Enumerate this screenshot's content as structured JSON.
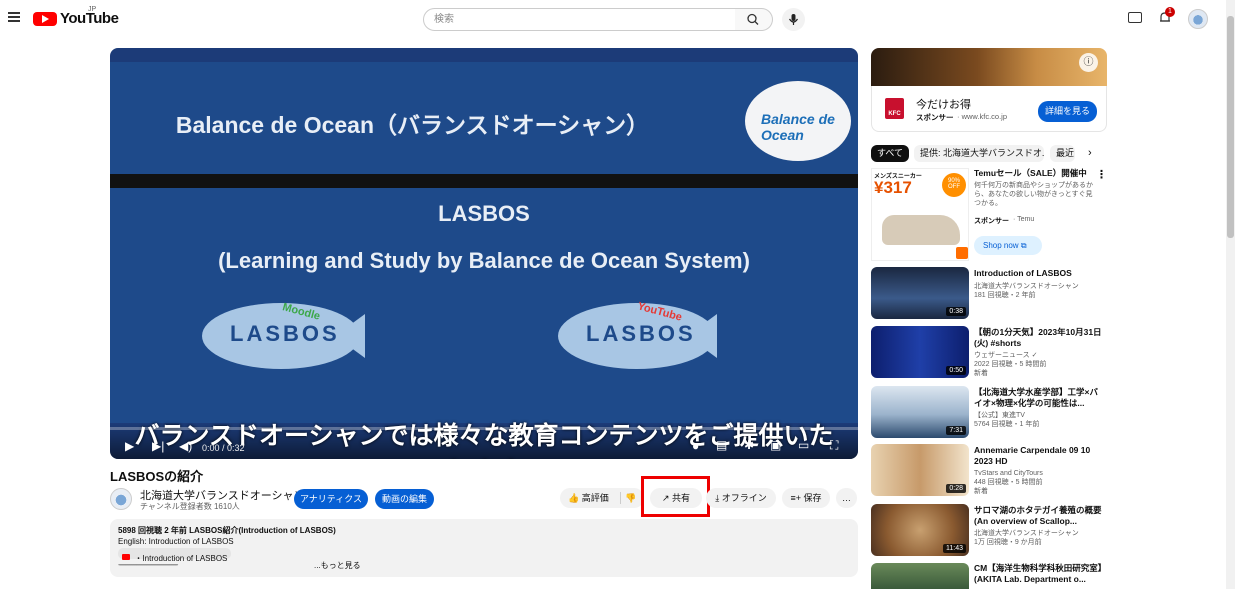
{
  "header": {
    "logo_text": "YouTube",
    "logo_region": "JP",
    "search_placeholder": "検索",
    "notification_count": "1"
  },
  "player": {
    "slide_title": "Balance de Ocean（バランスドオーシャン）",
    "logo_text": "Balance de Ocean",
    "lasbos_title": "LASBOS",
    "lasbos_subtitle": "(Learning and Study by Balance de Ocean System)",
    "fish_label": "LASBOS",
    "fish_tag_left": "Moodle",
    "fish_tag_right": "YouTube",
    "caption": "バランスドオーシャンでは様々な教育コンテンツをご提供いたします",
    "time": "0:00 / 0:32",
    "progress": 0
  },
  "video": {
    "title": "LASBOSの紹介",
    "channel_name": "北海道大学バランスドオーシャン",
    "subscribers": "チャンネル登録者数 1610人",
    "analytics_label": "アナリティクス",
    "edit_label": "動画の編集",
    "like_label": "高評価",
    "share_label": "共有",
    "offline_label": "オフライン",
    "save_label": "保存",
    "more_label": "…"
  },
  "description": {
    "stats": "5898 回視聴  2 年前  LASBOS紹介(Introduction of LASBOS)",
    "english": "English: Introduction of LASBOS",
    "playlist_link": "・Introduction of LASBOS",
    "divider": "----------------------------------------------------------------------------------------",
    "more": "...もっと見る"
  },
  "ad": {
    "title": "今だけお得",
    "sponsor": "スポンサー",
    "domain": "· www.kfc.co.jp",
    "cta": "詳細を見る",
    "logo_text": "KFC"
  },
  "chips": [
    "すべて",
    "提供: 北海道大学バランスドオ...",
    "最近"
  ],
  "sponsored": {
    "title": "Temuセール（SALE）開催中",
    "desc": "何千何万の新商品やショップがあるから、あなたの欲しい物がきっとすぐ見つかる。",
    "sponsor": "スポンサー",
    "brand": "· Temu",
    "cta": "Shop now",
    "price": "¥317",
    "badge": "90% OFF",
    "banner": "メンズスニーカー"
  },
  "recommendations": [
    {
      "title": "Introduction of LASBOS",
      "channel": "北海道大学バランスドオーシャン",
      "meta": "181 回視聴・2 年前",
      "badge": "",
      "duration": "0:38"
    },
    {
      "title": "【朝の1分天気】2023年10月31日(火) #shorts",
      "channel": "ウェザーニュース ✓",
      "meta": "2022 回視聴・5 時間前",
      "badge": "新着",
      "duration": "0:50"
    },
    {
      "title": "【北海道大学水産学部】工学×バイオ×物理×化学の可能性は...",
      "channel": "【公式】東進TV",
      "meta": "5764 回視聴・1 年前",
      "badge": "",
      "duration": "7:31"
    },
    {
      "title": "Annemarie Carpendale 09 10 2023 HD",
      "channel": "TvStars and CityTours",
      "meta": "448 回視聴・5 時間前",
      "badge": "新着",
      "duration": "0:28"
    },
    {
      "title": "サロマ湖のホタテガイ養殖の概要(An overview of Scallop...",
      "channel": "北海道大学バランスドオーシャン",
      "meta": "1万 回視聴・9 か月前",
      "badge": "",
      "duration": "11:43"
    },
    {
      "title": "CM【海洋生物科学科秋田研究室】(AKITA Lab. Department o...",
      "channel": "",
      "meta": "",
      "badge": "",
      "duration": ""
    }
  ]
}
